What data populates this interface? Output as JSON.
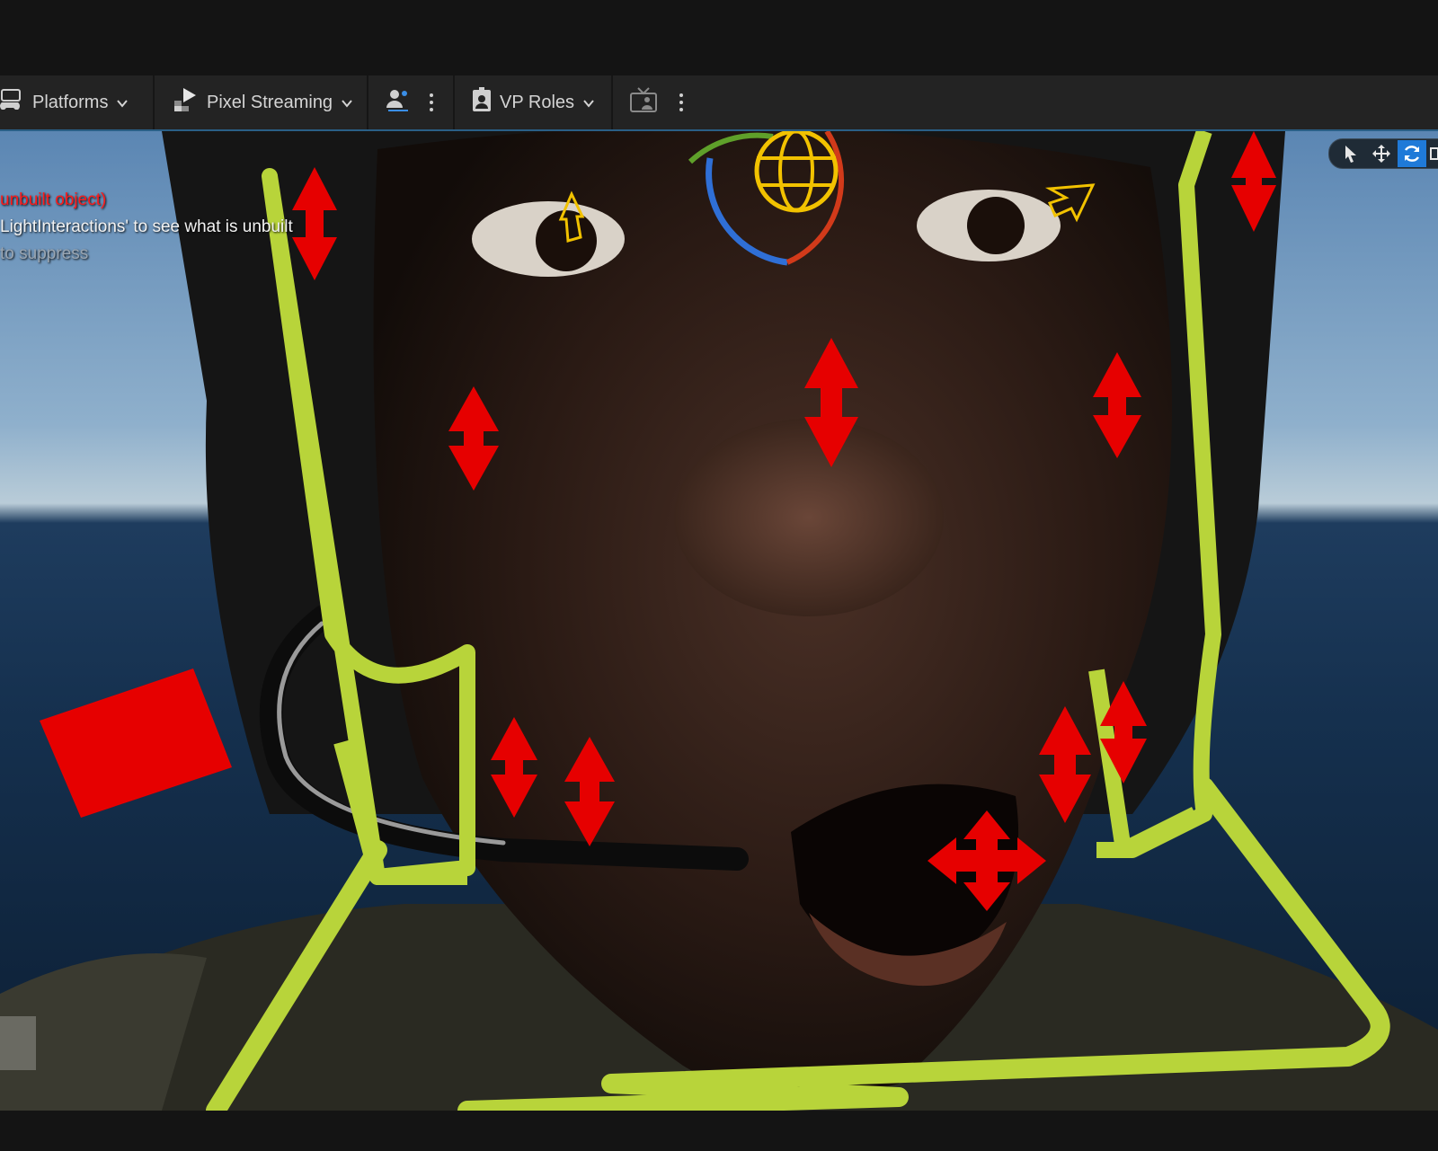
{
  "toolbar": {
    "platforms_label": "Platforms",
    "pixel_streaming_label": "Pixel Streaming",
    "vp_roles_label": "VP Roles"
  },
  "viewport": {
    "warnings": [
      "unbuilt object)",
      "LightInteractions' to see what is unbuilt",
      "to suppress"
    ]
  },
  "icons": {
    "platforms": "gamepad-icon",
    "pixel_streaming": "play-streaming-icon",
    "multi_user": "multi-user-icon",
    "vp_roles": "id-badge-icon",
    "broadcast": "tv-broadcast-icon",
    "select": "cursor-icon",
    "translate": "move-icon",
    "rotate": "rotate-icon"
  },
  "colors": {
    "toolbar_bg": "#232323",
    "accent_blue": "#1f7ad8",
    "control_red": "#e60000",
    "control_green": "#b8d43a",
    "gizmo_yellow": "#f2c200",
    "warning_red": "#ff1a1a"
  }
}
